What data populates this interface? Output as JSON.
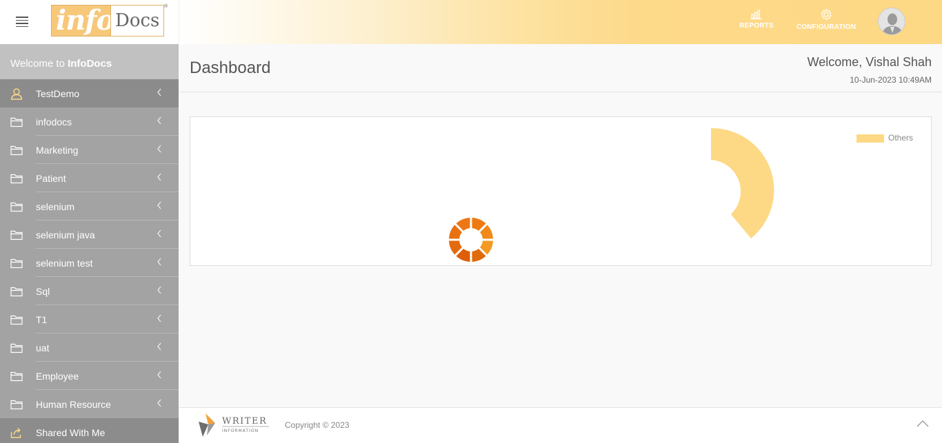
{
  "header": {
    "reports_label": "REPORTS",
    "configuration_label": "CONFIGURATION",
    "logo_info": "info",
    "logo_docs": "Docs",
    "logo_reg": "®",
    "brand_color": "#fdd985"
  },
  "sidebar": {
    "welcome_prefix": "Welcome to",
    "welcome_brand": "InfoDocs",
    "items": [
      {
        "label": "TestDemo",
        "icon": "user-icon",
        "active": true
      },
      {
        "label": "infodocs",
        "icon": "folder-icon"
      },
      {
        "label": "Marketing",
        "icon": "folder-icon"
      },
      {
        "label": "Patient",
        "icon": "folder-icon"
      },
      {
        "label": "selenium",
        "icon": "folder-icon"
      },
      {
        "label": "selenium java",
        "icon": "folder-icon"
      },
      {
        "label": "selenium test",
        "icon": "folder-icon"
      },
      {
        "label": "Sql",
        "icon": "folder-icon"
      },
      {
        "label": "T1",
        "icon": "folder-icon"
      },
      {
        "label": "uat",
        "icon": "folder-icon"
      },
      {
        "label": "Employee",
        "icon": "folder-icon"
      },
      {
        "label": "Human Resource",
        "icon": "folder-icon"
      }
    ],
    "shared_label": "Shared With Me"
  },
  "main": {
    "title": "Dashboard",
    "welcome_user": "Welcome, Vishal Shah",
    "datetime": "10-Jun-2023 10:49AM"
  },
  "chart_data": {
    "type": "pie",
    "legend": [
      "Others"
    ],
    "legend_position": "top-right",
    "colors": [
      "#fdd985"
    ]
  },
  "footer": {
    "copyright": "Copyright © 2023",
    "writer_logo_top": "WRITER",
    "writer_logo_bottom": "INFORMATION"
  }
}
